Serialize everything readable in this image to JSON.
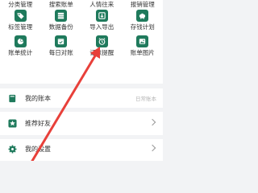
{
  "grid": {
    "items": [
      {
        "label": "分类管理",
        "icon": "category-icon"
      },
      {
        "label": "搜索账单",
        "icon": "search-bill-icon"
      },
      {
        "label": "人情往来",
        "icon": "gift-icon"
      },
      {
        "label": "报销管理",
        "icon": "reimburse-icon"
      },
      {
        "label": "标签管理",
        "icon": "tag-icon"
      },
      {
        "label": "数据备份",
        "icon": "backup-icon"
      },
      {
        "label": "导入导出",
        "icon": "import-export-icon"
      },
      {
        "label": "存钱计划",
        "icon": "piggy-bank-icon"
      },
      {
        "label": "账单统计",
        "icon": "pie-chart-icon"
      },
      {
        "label": "每日对账",
        "icon": "daily-check-icon"
      },
      {
        "label": "记账提醒",
        "icon": "alarm-clock-icon"
      },
      {
        "label": "账单图片",
        "icon": "image-icon"
      }
    ]
  },
  "list": {
    "my_ledger": {
      "label": "我的账本",
      "value": "日常账本"
    },
    "recommend": {
      "label": "推荐好友"
    },
    "settings": {
      "label": "我的设置"
    }
  },
  "colors": {
    "accent": "#1f7a5c",
    "arrow": "#e8403a"
  }
}
